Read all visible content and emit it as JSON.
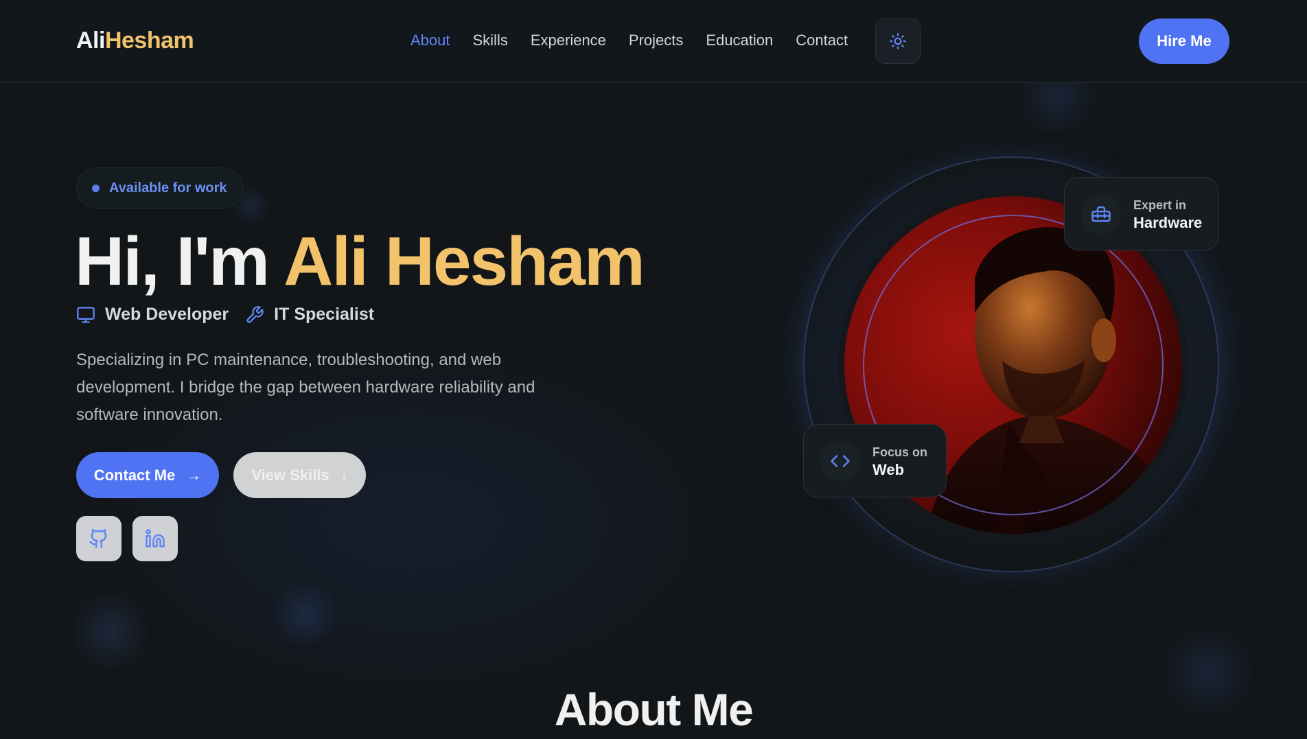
{
  "header": {
    "logo_first": "Ali",
    "logo_last": "Hesham",
    "nav": [
      {
        "label": "About",
        "active": true
      },
      {
        "label": "Skills",
        "active": false
      },
      {
        "label": "Experience",
        "active": false
      },
      {
        "label": "Projects",
        "active": false
      },
      {
        "label": "Education",
        "active": false
      },
      {
        "label": "Contact",
        "active": false
      }
    ],
    "theme_toggle_icon": "sun-icon",
    "hire_label": "Hire Me"
  },
  "hero": {
    "badge": "Available for work",
    "title_pre": "Hi, I'm ",
    "title_name": "Ali Hesham",
    "roles": [
      {
        "icon": "monitor-icon",
        "label": "Web Developer"
      },
      {
        "icon": "wrench-icon",
        "label": "IT Specialist"
      }
    ],
    "description": "Specializing in PC maintenance, troubleshooting, and web development. I bridge the gap between hardware reliability and software innovation.",
    "primary_cta": "Contact Me",
    "primary_cta_icon": "→",
    "secondary_cta": "View Skills",
    "secondary_cta_icon": "↓",
    "socials": [
      {
        "icon": "github-icon"
      },
      {
        "icon": "linkedin-icon"
      }
    ]
  },
  "profile": {
    "card_hardware": {
      "small": "Expert in",
      "big": "Hardware",
      "icon": "toolbox-icon"
    },
    "card_web": {
      "small": "Focus on",
      "big": "Web",
      "icon": "code-icon"
    }
  },
  "about": {
    "title": "About Me"
  },
  "colors": {
    "accent_blue": "#4f73f3",
    "accent_gold": "#f2c36b",
    "background": "#121619"
  }
}
